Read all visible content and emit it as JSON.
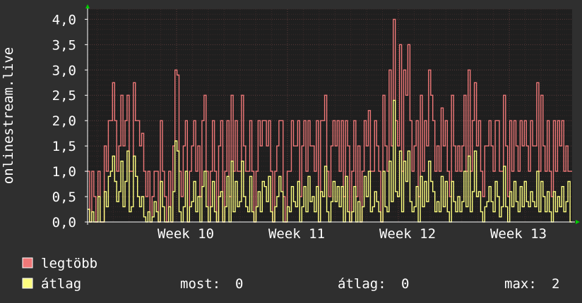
{
  "chart_data": {
    "type": "line",
    "ylabel": "onlinestream.live",
    "ylim": [
      0,
      4.2
    ],
    "y_ticks": [
      "0,0",
      "0,5",
      "1,0",
      "1,5",
      "2,0",
      "2,5",
      "3,0",
      "3,5",
      "4,0"
    ],
    "x_ticks": [
      "Week 10",
      "Week 11",
      "Week 12",
      "Week 13"
    ],
    "grid": true,
    "colors": {
      "background": "#2f2f2f",
      "plot": "#1f1f1f",
      "grid_minor": "#3a2a2a",
      "grid_major": "#5a3a3a",
      "axis": "#ffffff",
      "arrow": "#00cc00",
      "max_series": "#f07878",
      "avg_series": "#ffff80"
    },
    "series": [
      {
        "name": "legtöbb",
        "color": "#f07878",
        "values": [
          1,
          0,
          1,
          0.5,
          0,
          1,
          0,
          0,
          1.5,
          1,
          2,
          2,
          2.75,
          2,
          1,
          1.5,
          2.5,
          1.5,
          2,
          2.5,
          1,
          1,
          2.75,
          2,
          2,
          1.5,
          1.75,
          1,
          0.5,
          1,
          0,
          0.5,
          1,
          1,
          0,
          2,
          1,
          0.5,
          0,
          1,
          0,
          1.5,
          3,
          2.9,
          1,
          0.5,
          1.5,
          2,
          0,
          1,
          1.5,
          2,
          1,
          1.5,
          0.5,
          2,
          2.5,
          1,
          0,
          1,
          2,
          1,
          0,
          1.5,
          2,
          0,
          1,
          2,
          0.5,
          2.5,
          1,
          2,
          1,
          1,
          2.5,
          1.5,
          1,
          1,
          2,
          1,
          0,
          1,
          2,
          1.5,
          2,
          2,
          1.5,
          2,
          1,
          0,
          1,
          1.5,
          2,
          2,
          0.5,
          0,
          1,
          1,
          2,
          1.5,
          1.5,
          2,
          0.5,
          1.5,
          2,
          1,
          2,
          1.5,
          1.5,
          1,
          2,
          0,
          2,
          2,
          2.5,
          1,
          0.5,
          1.5,
          2,
          1.5,
          2,
          1,
          2,
          0.5,
          2,
          1.5,
          0,
          1,
          2,
          0.5,
          1.5,
          0,
          1,
          2,
          1.5,
          2.2,
          1,
          1,
          2,
          1.5,
          1,
          0,
          2.5,
          1.5,
          1,
          3,
          1.5,
          4,
          2,
          1.5,
          3.5,
          1,
          3,
          2.5,
          3.5,
          2,
          1,
          1.5,
          2,
          0.5,
          2.5,
          1,
          2,
          1.5,
          3,
          2.5,
          2,
          1,
          1.5,
          1,
          2.25,
          1.5,
          2,
          1,
          0.5,
          2.5,
          1.5,
          1,
          1.5,
          1,
          1.5,
          2.5,
          1,
          3,
          1,
          2,
          2.75,
          1.5,
          2,
          1,
          0.5,
          1.5,
          1.5,
          2,
          1.5,
          1,
          2,
          2,
          1,
          1,
          2.5,
          1.5,
          0.5,
          2,
          1,
          2,
          1.5,
          1,
          2,
          1.5,
          2,
          1.5,
          1,
          2,
          1.5,
          1.5,
          2.75,
          1,
          2.5,
          1.5,
          1,
          2,
          1,
          0.5,
          2,
          1,
          2,
          1.5,
          2,
          1,
          1.5,
          1,
          1
        ]
      },
      {
        "name": "átlag",
        "color": "#ffff80",
        "values": [
          0.25,
          0,
          0.2,
          0,
          0,
          0.5,
          0,
          0,
          0.6,
          0.3,
          0.9,
          1,
          1.3,
          0.8,
          0.4,
          0.6,
          1.2,
          0.3,
          0.8,
          1.4,
          0.2,
          0.3,
          1.3,
          0.9,
          0.5,
          0.3,
          0.5,
          0.1,
          0,
          0.2,
          0,
          0.1,
          0.4,
          0.2,
          0,
          0.8,
          0.3,
          0,
          0,
          0.3,
          0,
          0.6,
          1.6,
          1.4,
          0.2,
          0,
          0.3,
          1,
          0,
          0.3,
          0.4,
          0.8,
          0.2,
          0.5,
          0,
          0.7,
          1,
          0.3,
          0,
          0.3,
          0.8,
          0.2,
          0,
          0.5,
          0.6,
          0,
          0.3,
          0.9,
          0,
          1.2,
          0.2,
          0.8,
          0.3,
          0.4,
          1.2,
          0.5,
          0.3,
          0.2,
          0.9,
          0.2,
          0,
          0.3,
          0.6,
          0.2,
          0.8,
          0.7,
          0.4,
          0.9,
          0.2,
          0,
          0.3,
          0.5,
          0.9,
          0.6,
          0,
          0,
          0.3,
          0.2,
          0.7,
          0.4,
          0.3,
          0.8,
          0,
          0.3,
          0.7,
          0.2,
          0.9,
          0.4,
          0.5,
          0.2,
          0.7,
          0,
          0.6,
          0.5,
          1.1,
          0.2,
          0,
          0.4,
          0.8,
          0.4,
          0.7,
          0.3,
          0.7,
          0,
          0.9,
          0.2,
          0,
          0.2,
          0.7,
          0,
          0.4,
          0,
          0.3,
          0.9,
          0.5,
          1,
          0.2,
          0.3,
          0.6,
          0.4,
          0.2,
          0,
          1,
          0.3,
          0.2,
          1.2,
          0.4,
          2.4,
          0.6,
          0.5,
          1.4,
          0.2,
          1.2,
          0.8,
          1.4,
          0.4,
          0.2,
          0.3,
          0.7,
          0,
          0.9,
          0.3,
          0.8,
          0.4,
          1.2,
          0.8,
          0.6,
          0.2,
          0.4,
          0.2,
          0.9,
          0.3,
          0.8,
          0.2,
          0,
          0.8,
          0.4,
          0.2,
          0.5,
          0.2,
          0.4,
          1,
          0.3,
          1.3,
          0.2,
          0.6,
          1.4,
          0.5,
          0.6,
          0.2,
          0,
          0.3,
          0.4,
          0.7,
          0.4,
          0.2,
          0.8,
          0.5,
          0.1,
          0.3,
          1.1,
          0.3,
          0,
          0.6,
          0.3,
          0.8,
          0.4,
          0.2,
          0.7,
          0.3,
          0.8,
          0.4,
          0.3,
          0.6,
          0.4,
          0.3,
          1,
          0.2,
          0.8,
          0.5,
          0.2,
          0.6,
          0.2,
          0,
          0.6,
          0.2,
          0.5,
          0.3,
          0.7,
          0.2,
          0.4,
          0.8,
          0
        ]
      }
    ],
    "stats": {
      "most_label": "most:",
      "most_value": "0",
      "avg_label": "átlag:",
      "avg_value": "0",
      "max_label": "max:",
      "max_value": "2"
    }
  }
}
